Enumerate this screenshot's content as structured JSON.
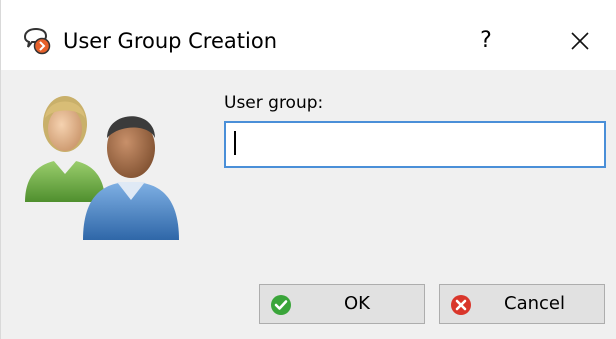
{
  "window": {
    "title": "User Group Creation",
    "help_label": "?",
    "close_label": "close"
  },
  "form": {
    "label": "User group:",
    "value": ""
  },
  "buttons": {
    "ok_label": "OK",
    "cancel_label": "Cancel"
  },
  "colors": {
    "focus_border": "#4a8fd8",
    "ok_icon": "#3aa53a",
    "cancel_icon": "#d9362b"
  },
  "icons": {
    "app": "user-group-app-icon",
    "avatar": "users-avatar-icon",
    "ok": "check-circle-icon",
    "cancel": "x-circle-icon"
  }
}
